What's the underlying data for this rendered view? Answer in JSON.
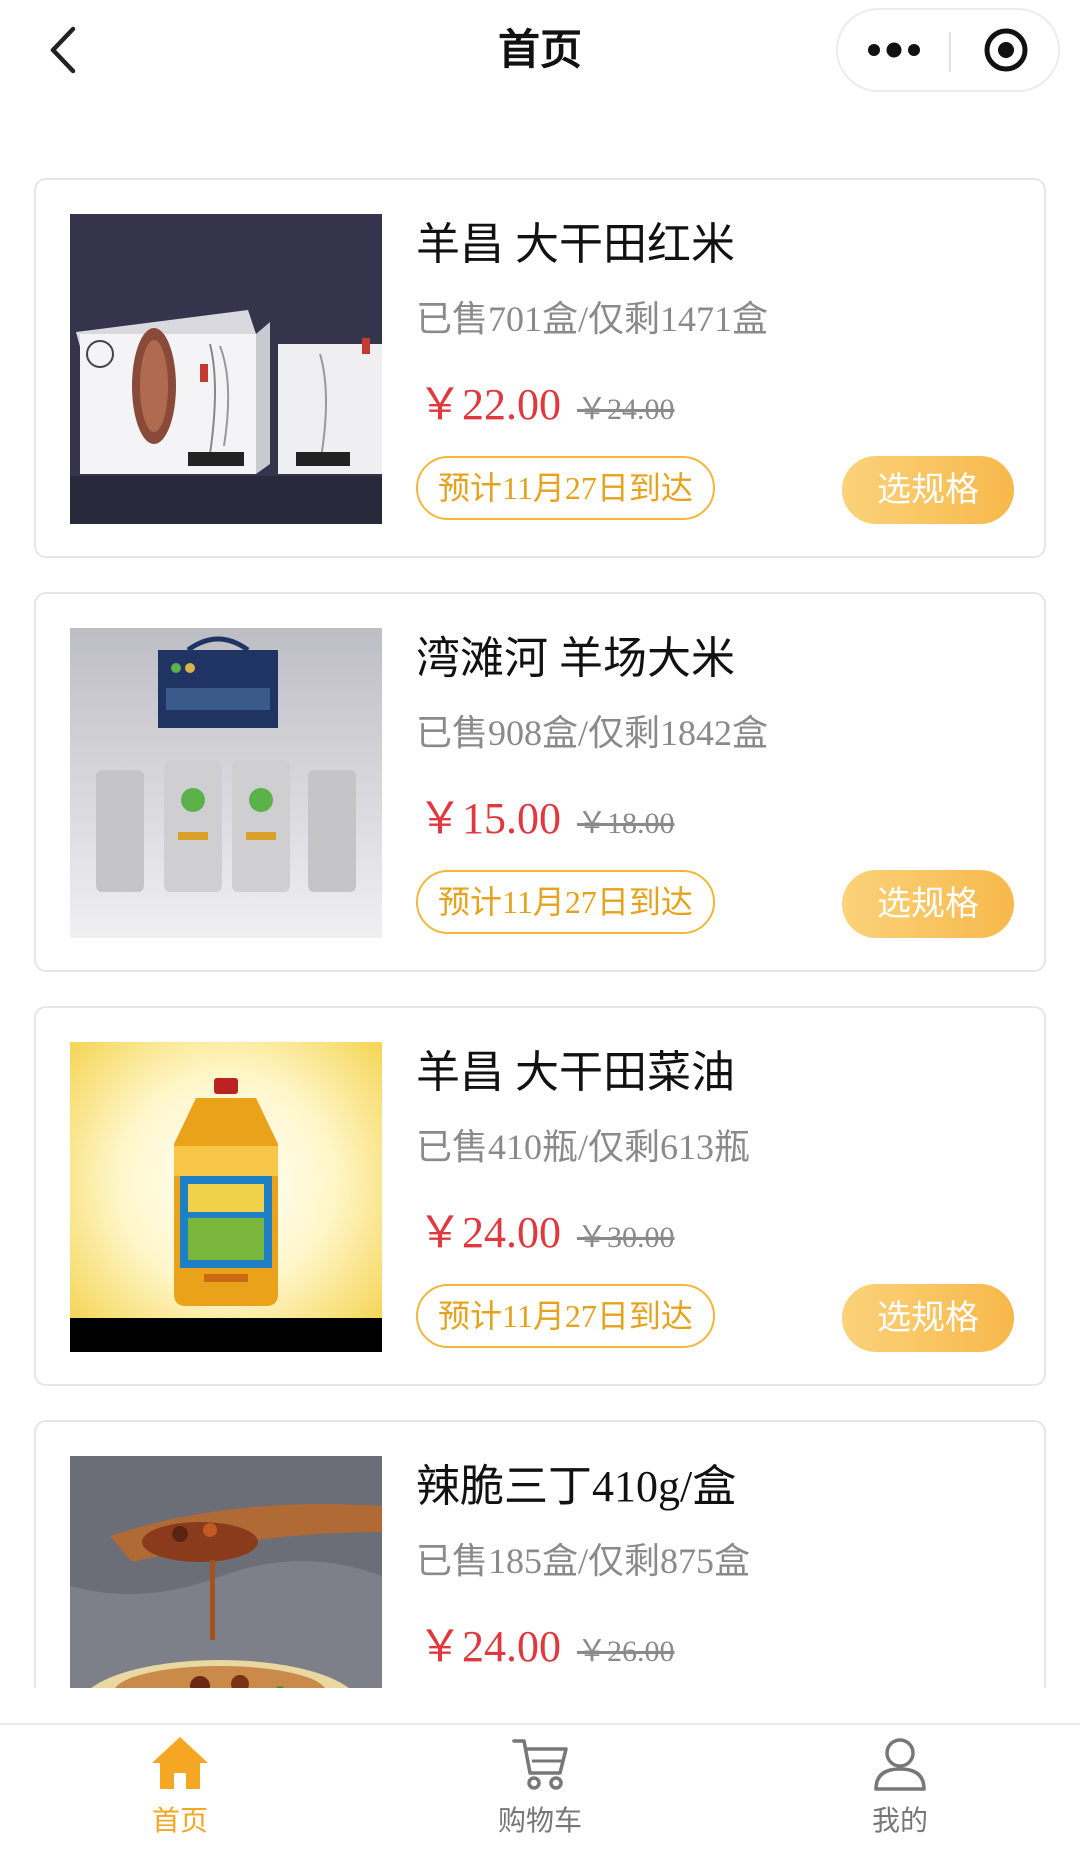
{
  "header": {
    "title": "首页"
  },
  "products": [
    {
      "name": "羊昌 大干田红米",
      "stock": "已售701盒/仅剩1471盒",
      "price": "￥22.00",
      "original_price": "￥24.00",
      "eta": "预计11月27日到达",
      "action": "选规格"
    },
    {
      "name": "湾滩河 羊场大米",
      "stock": "已售908盒/仅剩1842盒",
      "price": "￥15.00",
      "original_price": "￥18.00",
      "eta": "预计11月27日到达",
      "action": "选规格"
    },
    {
      "name": "羊昌 大干田菜油",
      "stock": "已售410瓶/仅剩613瓶",
      "price": "￥24.00",
      "original_price": "￥30.00",
      "eta": "预计11月27日到达",
      "action": "选规格"
    },
    {
      "name": "辣脆三丁410g/盒",
      "stock": "已售185盒/仅剩875盒",
      "price": "￥24.00",
      "original_price": "￥26.00"
    }
  ],
  "tabbar": {
    "items": [
      {
        "label": "首页",
        "icon": "home-icon",
        "active": true
      },
      {
        "label": "购物车",
        "icon": "cart-icon",
        "active": false
      },
      {
        "label": "我的",
        "icon": "user-icon",
        "active": false
      }
    ]
  },
  "colors": {
    "accent": "#f5a623",
    "price": "#e0383e",
    "eta_border": "#f2b63b"
  }
}
